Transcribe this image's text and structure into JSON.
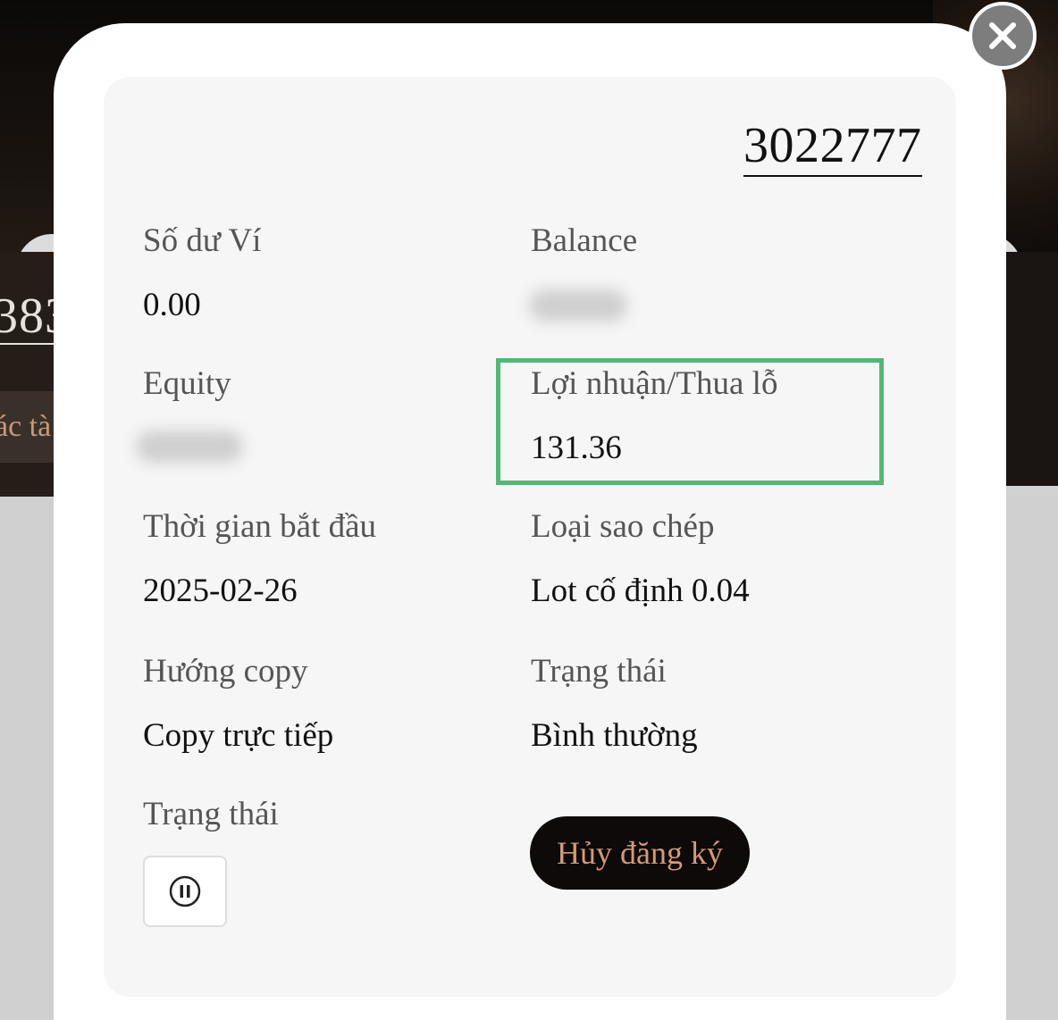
{
  "background": {
    "left_number": "383",
    "left_button_label": "ác tà"
  },
  "modal": {
    "close_icon": "close-icon",
    "account_number": "3022777",
    "fields": {
      "wallet_balance_label": "Số dư Ví",
      "wallet_balance_value": "0.00",
      "balance_label": "Balance",
      "equity_label": "Equity",
      "profit_loss_label": "Lợi nhuận/Thua lỗ",
      "profit_loss_value": "131.36",
      "start_time_label": "Thời gian bắt đầu",
      "start_time_value": "2025-02-26",
      "copy_type_label": "Loại sao chép",
      "copy_type_value": "Lot cố định 0.04",
      "copy_direction_label": "Hướng copy",
      "copy_direction_value": "Copy trực tiếp",
      "status_label": "Trạng thái",
      "status_value": "Bình thường",
      "status_label_2": "Trạng thái"
    },
    "pause_icon": "pause-icon",
    "cancel_button_label": "Hủy đăng ký"
  },
  "colors": {
    "highlight": "#4fba73",
    "cancel_button_bg": "#0d0a09",
    "cancel_button_text": "#d49a74"
  }
}
